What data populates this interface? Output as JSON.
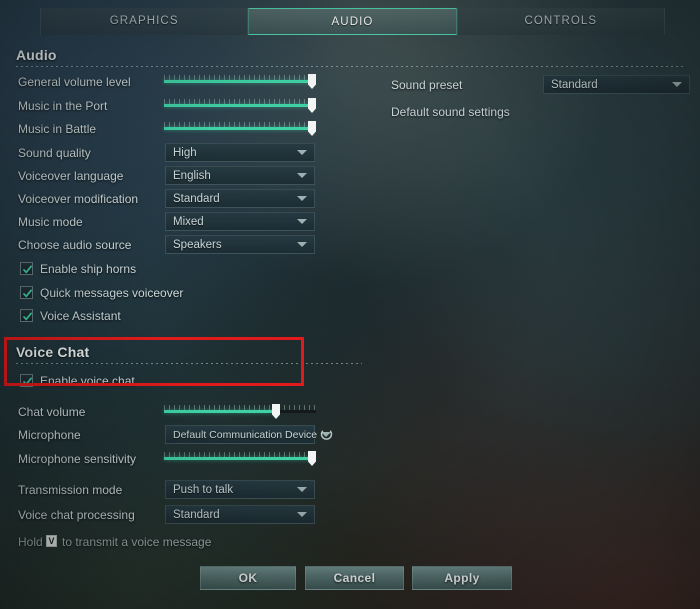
{
  "tabs": [
    {
      "label": "GRAPHICS",
      "active": false
    },
    {
      "label": "AUDIO",
      "active": true
    },
    {
      "label": "CONTROLS",
      "active": false
    }
  ],
  "audio_section": {
    "title": "Audio",
    "sliders": [
      {
        "label": "General volume level",
        "value": 100
      },
      {
        "label": "Music in the Port",
        "value": 100
      },
      {
        "label": "Music in Battle",
        "value": 100
      }
    ],
    "dropdowns": [
      {
        "label": "Sound quality",
        "value": "High"
      },
      {
        "label": "Voiceover language",
        "value": "English"
      },
      {
        "label": "Voiceover modification",
        "value": "Standard"
      },
      {
        "label": "Music mode",
        "value": "Mixed"
      },
      {
        "label": "Choose audio source",
        "value": "Speakers"
      }
    ],
    "checkboxes": [
      {
        "label": "Enable ship horns",
        "checked": true
      },
      {
        "label": "Quick messages voiceover",
        "checked": true
      },
      {
        "label": "Voice Assistant",
        "checked": true
      }
    ]
  },
  "right_column": {
    "sound_preset_label": "Sound preset",
    "sound_preset_value": "Standard",
    "default_sound_settings": "Default sound settings"
  },
  "voice_chat_section": {
    "title": "Voice Chat",
    "enable_label": "Enable voice chat",
    "enable_checked": true,
    "chat_volume_label": "Chat volume",
    "chat_volume_value": 75,
    "microphone_label": "Microphone",
    "microphone_value": "Default Communication Device",
    "refresh_icon": "refresh-icon",
    "mic_sensitivity_label": "Microphone sensitivity",
    "mic_sensitivity_value": 100,
    "transmission_mode_label": "Transmission mode",
    "transmission_mode_value": "Push to talk",
    "processing_label": "Voice chat processing",
    "processing_value": "Standard",
    "hint_prefix": "Hold",
    "hint_key": "V",
    "hint_suffix": "to transmit a voice message"
  },
  "footer": {
    "ok": "OK",
    "cancel": "Cancel",
    "apply": "Apply"
  },
  "annotation": {
    "color": "#e11b1b",
    "shape": "rectangle"
  },
  "colors": {
    "accent_teal": "#3fd1a4",
    "tab_active_border": "#4fd6b2",
    "annotation_red": "#e11b1b",
    "text_primary": "#e9eff0",
    "text_secondary": "#cdd9da"
  }
}
